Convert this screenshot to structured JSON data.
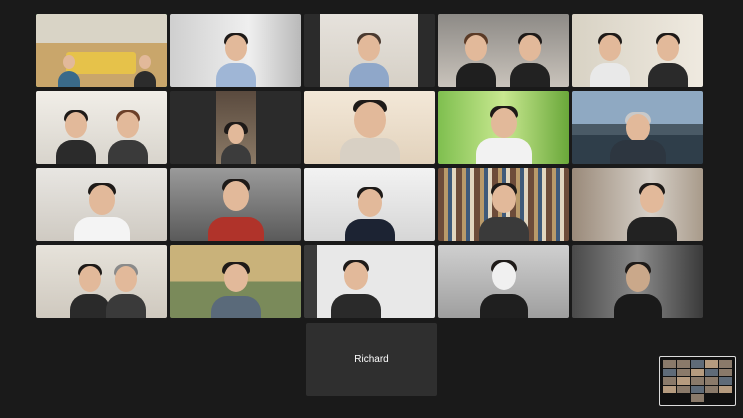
{
  "meeting": {
    "self_name": "Richard"
  },
  "colors": {
    "background": "#1a1a1a",
    "active_speaker_outline": "#2ed35a",
    "name_tile": "#2f2f2f"
  },
  "participants": [
    {
      "tile": "classroom-group",
      "active": true
    },
    {
      "tile": "participant-2"
    },
    {
      "tile": "participant-3"
    },
    {
      "tile": "participant-4"
    },
    {
      "tile": "participant-5"
    },
    {
      "tile": "participant-6"
    },
    {
      "tile": "participant-7"
    },
    {
      "tile": "participant-8"
    },
    {
      "tile": "participant-9"
    },
    {
      "tile": "participant-10"
    },
    {
      "tile": "participant-11"
    },
    {
      "tile": "participant-12"
    },
    {
      "tile": "participant-13"
    },
    {
      "tile": "participant-14"
    },
    {
      "tile": "participant-15"
    },
    {
      "tile": "participant-16"
    },
    {
      "tile": "participant-17"
    },
    {
      "tile": "participant-18"
    },
    {
      "tile": "participant-19"
    },
    {
      "tile": "participant-20"
    }
  ],
  "icons": {
    "self_view_minimized": "mini-gallery-icon"
  }
}
